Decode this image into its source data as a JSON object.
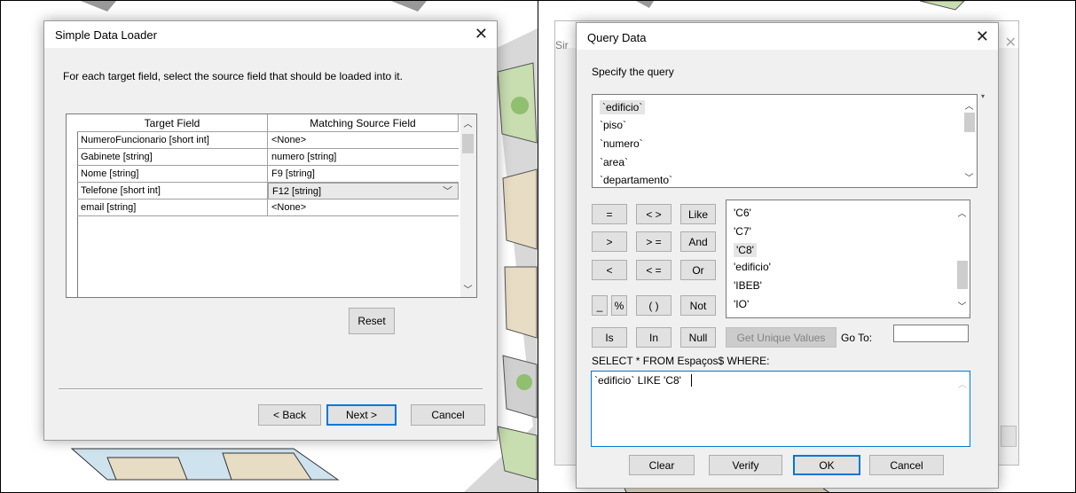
{
  "loader": {
    "title": "Simple Data Loader",
    "instruction": "For each target field, select the source field that should be loaded into it.",
    "columns": [
      "Target Field",
      "Matching Source Field"
    ],
    "rows": [
      {
        "target": "NumeroFuncionario [short int]",
        "source": "<None>"
      },
      {
        "target": "Gabinete [string]",
        "source": "numero [string]"
      },
      {
        "target": "Nome [string]",
        "source": "F9 [string]"
      },
      {
        "target": "Telefone [short int]",
        "source": "F12 [string]"
      },
      {
        "target": "email [string]",
        "source": "<None>"
      }
    ],
    "reset_label": "Reset",
    "back_label": "< Back",
    "next_label": "Next >",
    "cancel_label": "Cancel"
  },
  "query": {
    "title": "Query Data",
    "behind_prefix": "Sir",
    "specify_label": "Specify the query",
    "fields": [
      "`edificio`",
      "`piso`",
      "`numero`",
      "`area`",
      "`departamento`"
    ],
    "operators": [
      "=",
      "< >",
      "Like",
      "> ",
      "> =",
      "And",
      "<",
      "< =",
      "Or",
      "_",
      "%",
      "( )",
      "Not",
      "Is",
      "In",
      "Null"
    ],
    "values": [
      "'C6'",
      "'C7'",
      "'C8'",
      "'edificio'",
      "'IBEB'",
      "'IO'"
    ],
    "unique_values_label": "Get Unique Values",
    "goto_label": "Go To:",
    "goto_value": "",
    "sql_prefix": "SELECT * FROM Espaços$ WHERE:",
    "expression": "`edificio` LIKE 'C8'",
    "clear_label": "Clear",
    "verify_label": "Verify",
    "ok_label": "OK",
    "cancel_label": "Cancel"
  }
}
